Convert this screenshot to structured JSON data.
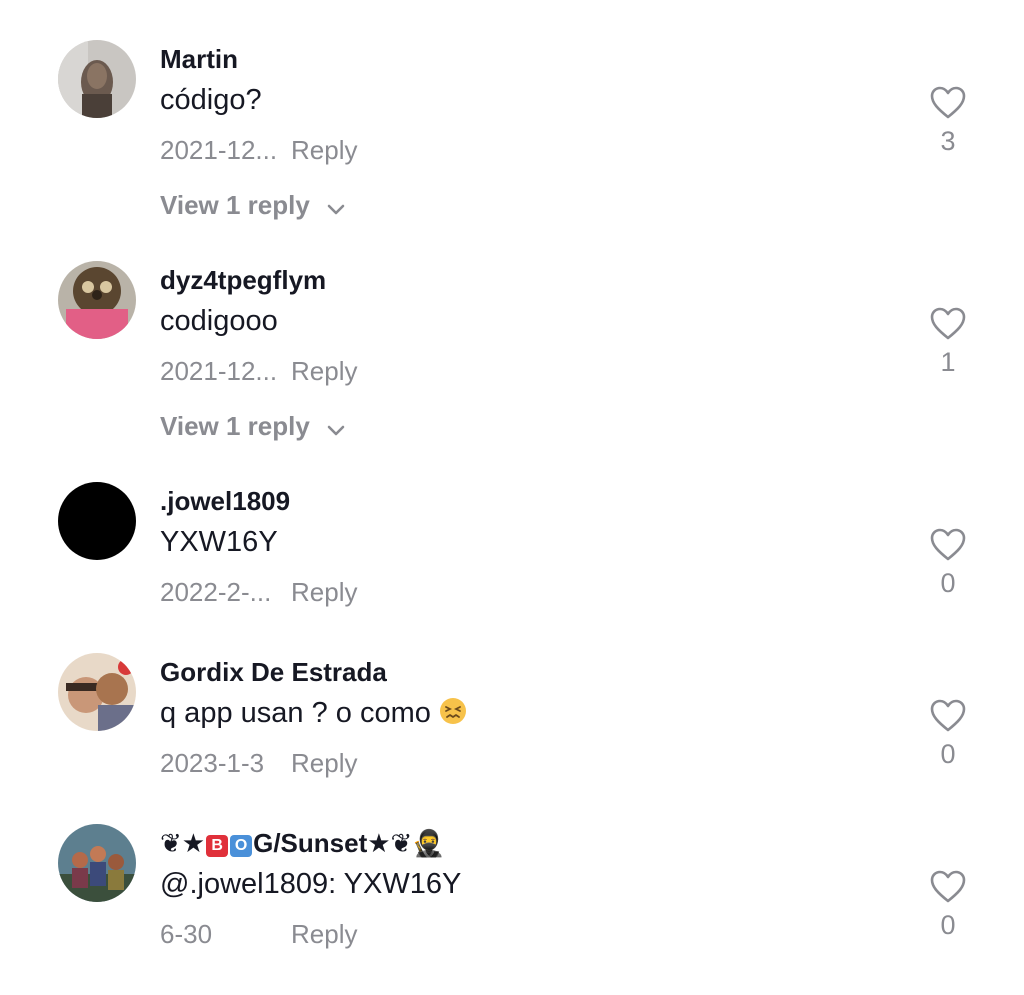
{
  "comments": [
    {
      "username": "Martin",
      "text": "código?",
      "date": "2021-12...",
      "reply_label": "Reply",
      "likes": "3",
      "view_replies": "View 1 reply"
    },
    {
      "username": "dyz4tpegflym",
      "text": "codigooo",
      "date": "2021-12...",
      "reply_label": "Reply",
      "likes": "1",
      "view_replies": "View 1 reply"
    },
    {
      "username": ".jowel1809",
      "text": "YXW16Y",
      "date": "2022-2-...",
      "reply_label": "Reply",
      "likes": "0"
    },
    {
      "username": "Gordix De Estrada",
      "text": "q app usan ? o como",
      "emoji": "confounded-face-icon",
      "date": "2023-1-3",
      "reply_label": "Reply",
      "likes": "0"
    },
    {
      "username_parts": [
        "❦★",
        "B",
        "O",
        "G/Sunset★❦",
        "🥷"
      ],
      "text": "@.jowel1809: YXW16Y",
      "date": "6-30",
      "reply_label": "Reply",
      "likes": "0"
    }
  ],
  "colors": {
    "primary_text": "#161823",
    "secondary_text": "#8a8b91",
    "badge_red": "#e0303a",
    "badge_blue": "#4a90d9"
  }
}
